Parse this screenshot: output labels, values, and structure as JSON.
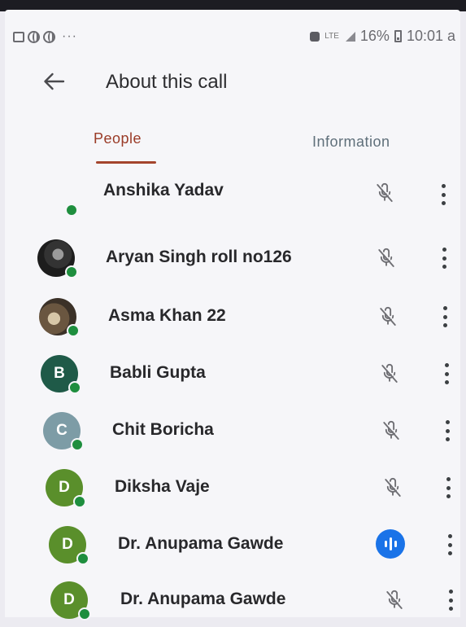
{
  "status_bar": {
    "more_dots": "···",
    "network_label": "LTE",
    "battery": "16%",
    "time": "10:01 a"
  },
  "header": {
    "title": "About this call"
  },
  "tabs": [
    {
      "label": "People",
      "active": true
    },
    {
      "label": "Information",
      "active": false
    }
  ],
  "colors": {
    "accent": "#a4452d",
    "online": "#1e8e3e",
    "speaking": "#1a73e8"
  },
  "participants": [
    {
      "name": "Anshika Yadav",
      "initial": "",
      "avatar_color": "",
      "avatar_type": "none",
      "mic": "muted"
    },
    {
      "name": "Aryan Singh roll no126",
      "initial": "",
      "avatar_color": "",
      "avatar_type": "photo1",
      "mic": "muted"
    },
    {
      "name": "Asma Khan 22",
      "initial": "",
      "avatar_color": "",
      "avatar_type": "photo2",
      "mic": "muted"
    },
    {
      "name": "Babli Gupta",
      "initial": "B",
      "avatar_color": "#1f5a48",
      "avatar_type": "letter",
      "mic": "muted"
    },
    {
      "name": "Chit Boricha",
      "initial": "C",
      "avatar_color": "#7d9ca6",
      "avatar_type": "letter",
      "mic": "muted"
    },
    {
      "name": "Diksha Vaje",
      "initial": "D",
      "avatar_color": "#5a8f2b",
      "avatar_type": "letter",
      "mic": "muted"
    },
    {
      "name": "Dr. Anupama Gawde",
      "initial": "D",
      "avatar_color": "#5a8f2b",
      "avatar_type": "letter",
      "mic": "speaking"
    },
    {
      "name": "Dr. Anupama Gawde",
      "initial": "D",
      "avatar_color": "#5a8f2b",
      "avatar_type": "letter",
      "mic": "muted"
    }
  ]
}
